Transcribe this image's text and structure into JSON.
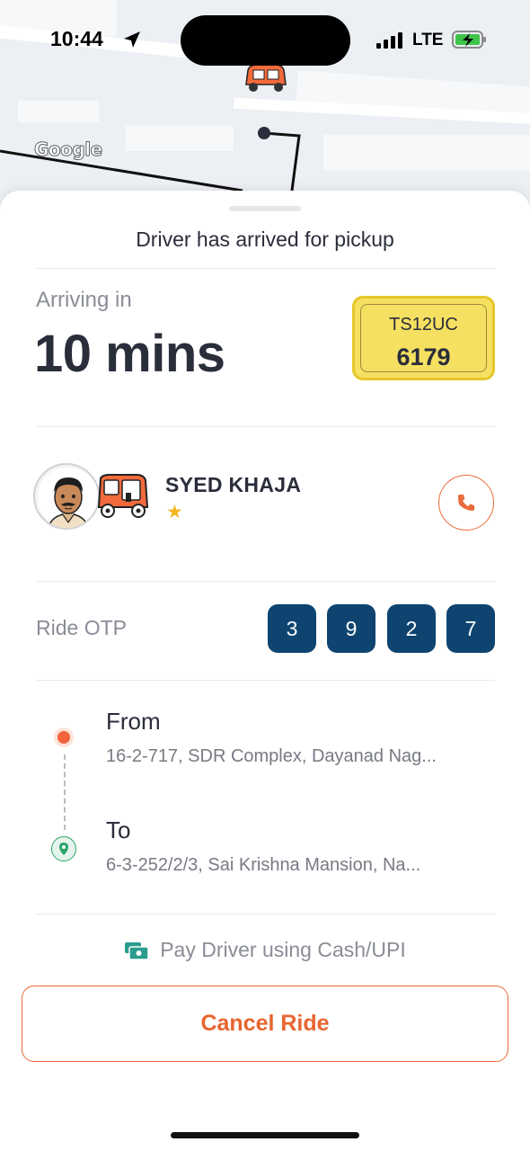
{
  "status_bar": {
    "time": "10:44",
    "network": "LTE"
  },
  "map": {
    "attribution": "Google"
  },
  "sheet": {
    "title": "Driver has arrived for pickup",
    "eta_label": "Arriving in",
    "eta_value": "10 mins",
    "vehicle_plate": {
      "line1": "TS12UC",
      "line2": "6179"
    },
    "driver": {
      "name": "SYED KHAJA",
      "rating_icon": "star-icon"
    },
    "otp": {
      "label": "Ride OTP",
      "digits": [
        "3",
        "9",
        "2",
        "7"
      ]
    },
    "route": {
      "from_label": "From",
      "from_address": "16-2-717, SDR Complex, Dayanad Nag...",
      "to_label": "To",
      "to_address": "6-3-252/2/3, Sai Krishna Mansion, Na..."
    },
    "payment_note": "Pay Driver using Cash/UPI",
    "cancel_label": "Cancel Ride"
  },
  "colors": {
    "accent": "#E8652F",
    "otp_bg": "#0F4470",
    "plate_bg": "#F6E062",
    "pickup_dot": "#F2633A",
    "drop_pin": "#2DA46A",
    "text_primary": "#2A2D3A",
    "text_secondary": "#8A8D96"
  }
}
